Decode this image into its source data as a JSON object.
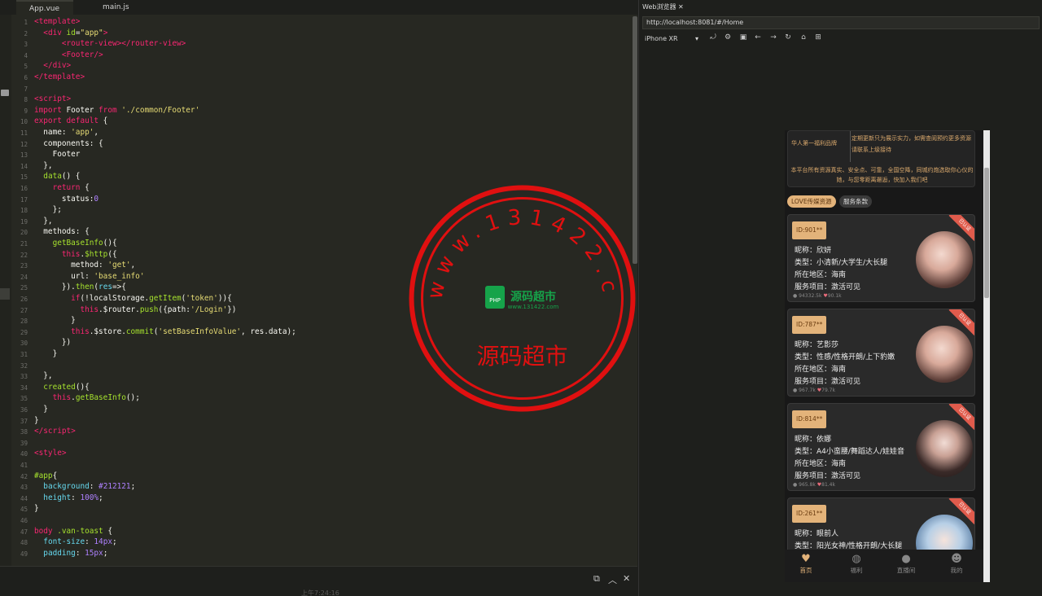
{
  "editor": {
    "tabs": [
      {
        "label": "App.vue",
        "active": true
      },
      {
        "label": "main.js",
        "active": false
      }
    ],
    "line_numbers": [
      "1",
      "2",
      "3",
      "4",
      "5",
      "6",
      "7",
      "8",
      "9",
      "10",
      "11",
      "12",
      "13",
      "14",
      "15",
      "16",
      "17",
      "18",
      "19",
      "20",
      "21",
      "22",
      "23",
      "24",
      "25",
      "26",
      "27",
      "28",
      "29",
      "30",
      "31",
      "32",
      "33",
      "34",
      "35",
      "36",
      "37",
      "38",
      "39",
      "40",
      "41",
      "42",
      "43",
      "44",
      "45",
      "46",
      "47",
      "48",
      "49"
    ],
    "timestamp": "上午7:24:16"
  },
  "browser": {
    "tab_title": "Web浏览器",
    "url": "http://localhost:8081/#/Home",
    "device": "iPhone XR"
  },
  "phone": {
    "banner_left": "华人第一福利品牌",
    "banner_right": "定期更新只为展示实力，如需查阅预约更多资源请联系上级接待",
    "banner_bottom": "本平台所有资源真实、安全点、可靠，全国空降，同城约炮选取你心仪的她，与您零距离邂逅，快加入我们吧",
    "chips": [
      "LOVE传媒资源",
      "服务条款"
    ],
    "cards": [
      {
        "id": "ID:901**",
        "nick": "昵称：欣妍",
        "type": "类型：小清新/大学生/大长腿",
        "area": "所在地区：海南",
        "service": "服务项目：激活可见",
        "views": "94332.5k",
        "likes": "90.1k",
        "tag": "已认证"
      },
      {
        "id": "ID:787**",
        "nick": "昵称：艺影莎",
        "type": "类型：性感/性格开朗/上下豹嫩",
        "area": "所在地区：海南",
        "service": "服务项目：激活可见",
        "views": "967.7k",
        "likes": "79.7k",
        "tag": "已认证"
      },
      {
        "id": "ID:814**",
        "nick": "昵称：依娜",
        "type": "类型：A4小蛮腰/舞蹈达人/娃娃音",
        "area": "所在地区：海南",
        "service": "服务项目：激活可见",
        "views": "965.8k",
        "likes": "81.4k",
        "tag": "已认证"
      },
      {
        "id": "ID:261**",
        "nick": "昵称：眼前人",
        "type": "类型：阳光女神/性格开朗/大长腿",
        "area": "",
        "service": "",
        "views": "",
        "likes": "",
        "tag": "已认证"
      }
    ],
    "footer": [
      {
        "label": "首页",
        "icon": "heart-icon",
        "color": "#e3b37a"
      },
      {
        "label": "福利",
        "icon": "compass-icon",
        "color": "#888888"
      },
      {
        "label": "直播间",
        "icon": "chat-icon",
        "color": "#888888"
      },
      {
        "label": "我的",
        "icon": "user-icon",
        "color": "#888888"
      }
    ]
  },
  "watermark": {
    "ring_text": "www.131422.com",
    "center_brand": "源码超市",
    "center_url": "www.131422.com",
    "bottom_text": "源码超市",
    "color": "#e01010"
  }
}
